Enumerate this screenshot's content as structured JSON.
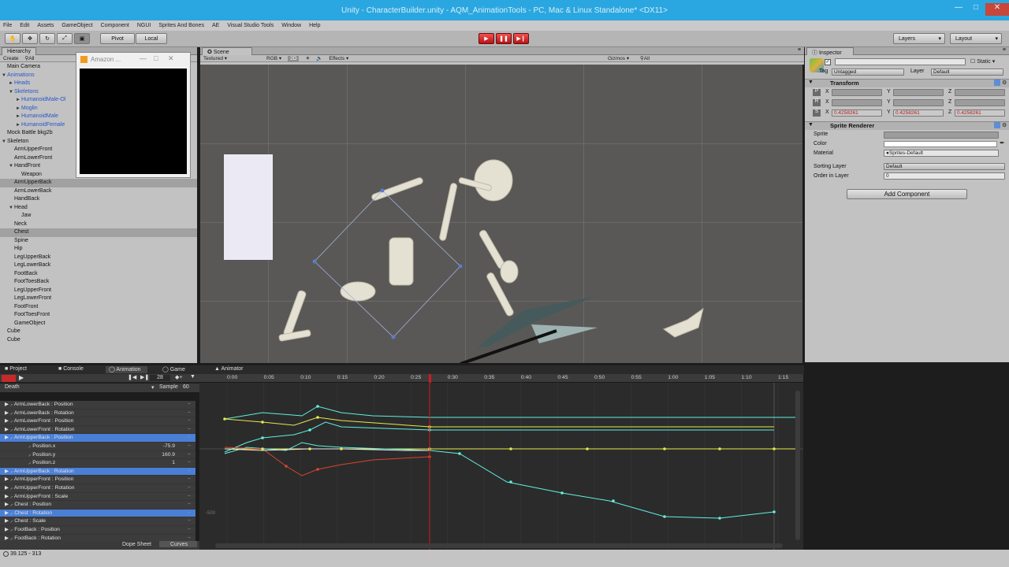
{
  "window": {
    "title": "Unity - CharacterBuilder.unity - AQM_AnimationTools - PC, Mac & Linux Standalone* <DX11>"
  },
  "menu": [
    "File",
    "Edit",
    "Assets",
    "GameObject",
    "Component",
    "NGUI",
    "Sprites And Bones",
    "AE",
    "Visual Studio Tools",
    "Window",
    "Help"
  ],
  "toolbar": {
    "pivot": "Pivot",
    "local": "Local",
    "layers": "Layers",
    "layout": "Layout"
  },
  "hierarchy": {
    "tab": "Hierarchy",
    "create": "Create",
    "search": "All",
    "items": [
      {
        "label": "Main Camera",
        "indent": 0,
        "arrow": "",
        "style": ""
      },
      {
        "label": "Animations",
        "indent": 0,
        "arrow": "▼",
        "style": "blue"
      },
      {
        "label": "Heads",
        "indent": 1,
        "arrow": "►",
        "style": "blue"
      },
      {
        "label": "Skeletons",
        "indent": 1,
        "arrow": "▼",
        "style": "blue"
      },
      {
        "label": "HumanoidMale-Ol",
        "indent": 2,
        "arrow": "►",
        "style": "blue"
      },
      {
        "label": "Moglin",
        "indent": 2,
        "arrow": "►",
        "style": "blue"
      },
      {
        "label": "HumanoidMale",
        "indent": 2,
        "arrow": "►",
        "style": "blue"
      },
      {
        "label": "HumanoidFemale",
        "indent": 2,
        "arrow": "►",
        "style": "blue"
      },
      {
        "label": "Mock Battle bkg2b",
        "indent": 0,
        "arrow": "",
        "style": ""
      },
      {
        "label": "Skeleton",
        "indent": 0,
        "arrow": "▼",
        "style": ""
      },
      {
        "label": "ArmUpperFront",
        "indent": 1,
        "arrow": "",
        "style": ""
      },
      {
        "label": "ArmLowerFront",
        "indent": 1,
        "arrow": "",
        "style": ""
      },
      {
        "label": "HandFront",
        "indent": 1,
        "arrow": "▼",
        "style": ""
      },
      {
        "label": "Weapon",
        "indent": 2,
        "arrow": "",
        "style": ""
      },
      {
        "label": "ArmUpperBack",
        "indent": 1,
        "arrow": "",
        "style": "sel"
      },
      {
        "label": "ArmLowerBack",
        "indent": 1,
        "arrow": "",
        "style": ""
      },
      {
        "label": "HandBack",
        "indent": 1,
        "arrow": "",
        "style": ""
      },
      {
        "label": "Head",
        "indent": 1,
        "arrow": "▼",
        "style": ""
      },
      {
        "label": "Jaw",
        "indent": 2,
        "arrow": "",
        "style": ""
      },
      {
        "label": "Neck",
        "indent": 1,
        "arrow": "",
        "style": ""
      },
      {
        "label": "Chest",
        "indent": 1,
        "arrow": "",
        "style": "sel"
      },
      {
        "label": "Spine",
        "indent": 1,
        "arrow": "",
        "style": ""
      },
      {
        "label": "Hip",
        "indent": 1,
        "arrow": "",
        "style": ""
      },
      {
        "label": "LegUpperBack",
        "indent": 1,
        "arrow": "",
        "style": ""
      },
      {
        "label": "LegLowerBack",
        "indent": 1,
        "arrow": "",
        "style": ""
      },
      {
        "label": "FootBack",
        "indent": 1,
        "arrow": "",
        "style": ""
      },
      {
        "label": "FootToesBack",
        "indent": 1,
        "arrow": "",
        "style": ""
      },
      {
        "label": "LegUpperFront",
        "indent": 1,
        "arrow": "",
        "style": ""
      },
      {
        "label": "LegLowerFront",
        "indent": 1,
        "arrow": "",
        "style": ""
      },
      {
        "label": "FootFront",
        "indent": 1,
        "arrow": "",
        "style": ""
      },
      {
        "label": "FootToesFront",
        "indent": 1,
        "arrow": "",
        "style": ""
      },
      {
        "label": "GameObject",
        "indent": 1,
        "arrow": "",
        "style": ""
      },
      {
        "label": "Cube",
        "indent": 0,
        "arrow": "",
        "style": ""
      },
      {
        "label": "Cube",
        "indent": 0,
        "arrow": "",
        "style": ""
      }
    ]
  },
  "popup": {
    "title": "Amazon ..."
  },
  "scene": {
    "tab": "Scene",
    "shading": "Textured",
    "rgb": "RGB",
    "mode2d": "2D",
    "effects": "Effects",
    "gizmos": "Gizmos",
    "search": "All"
  },
  "inspector": {
    "tab": "Inspector",
    "static": "Static",
    "tag_label": "Tag",
    "tag_value": "Untagged",
    "layer_label": "Layer",
    "layer_value": "Default",
    "transform": "Transform",
    "scale": {
      "x": "0.4258261",
      "y": "0.4258261",
      "z": "0.4258261"
    },
    "axis_labels": [
      "X",
      "Y",
      "Z"
    ],
    "sprite_renderer": "Sprite Renderer",
    "sprite_label": "Sprite",
    "color_label": "Color",
    "material_label": "Material",
    "material_value": "Sprites-Default",
    "sorting_layer_label": "Sorting Layer",
    "sorting_layer_value": "Default",
    "order_label": "Order in Layer",
    "order_value": "0",
    "add_component": "Add Component"
  },
  "bottom_tabs": {
    "project": "Project",
    "console": "Console",
    "animation": "Animation",
    "game": "Game",
    "animator": "Animator"
  },
  "animation": {
    "frame": "28",
    "clip": "Death",
    "sample_label": "Sample",
    "sample_value": "60",
    "dope_sheet": "Dope Sheet",
    "curves": "Curves",
    "ruler": [
      "0:00",
      "0:05",
      "0:10",
      "0:15",
      "0:20",
      "0:25",
      "0:30",
      "0:35",
      "0:40",
      "0:45",
      "0:50",
      "0:55",
      "1:00",
      "1:05",
      "1:10",
      "1:15"
    ],
    "axis_label": "-500",
    "rows": [
      {
        "label": "ArmLowerBack : Position",
        "kind": "prop",
        "value": "",
        "hl": false
      },
      {
        "label": "ArmLowerBack : Rotation",
        "kind": "prop",
        "value": "",
        "hl": false
      },
      {
        "label": "ArmLowerFront : Position",
        "kind": "prop",
        "value": "",
        "hl": false
      },
      {
        "label": "ArmLowerFront : Rotation",
        "kind": "prop",
        "value": "",
        "hl": false
      },
      {
        "label": "ArmUpperBack : Position",
        "kind": "prop",
        "value": "",
        "hl": true
      },
      {
        "label": "Position.x",
        "kind": "sub",
        "value": "-75.9",
        "hl": false
      },
      {
        "label": "Position.y",
        "kind": "sub",
        "value": "160.9",
        "hl": false
      },
      {
        "label": "Position.z",
        "kind": "sub",
        "value": "1",
        "hl": false
      },
      {
        "label": "ArmUpperBack : Rotation",
        "kind": "prop",
        "value": "",
        "hl": true
      },
      {
        "label": "ArmUpperFront : Position",
        "kind": "prop",
        "value": "",
        "hl": false
      },
      {
        "label": "ArmUpperFront : Rotation",
        "kind": "prop",
        "value": "",
        "hl": false
      },
      {
        "label": "ArmUpperFront : Scale",
        "kind": "prop",
        "value": "",
        "hl": false
      },
      {
        "label": "Chest : Position",
        "kind": "prop",
        "value": "",
        "hl": false
      },
      {
        "label": "Chest : Rotation",
        "kind": "prop",
        "value": "",
        "hl": true
      },
      {
        "label": "Chest : Scale",
        "kind": "prop",
        "value": "",
        "hl": false
      },
      {
        "label": "FootBack : Position",
        "kind": "prop",
        "value": "",
        "hl": false
      },
      {
        "label": "FootBack : Rotation",
        "kind": "prop",
        "value": "",
        "hl": false
      }
    ]
  },
  "status": {
    "text": "39.125 - 313"
  },
  "colors": {
    "accent_blue": "#4a7fd6",
    "curve_cyan": "#5ff0e0",
    "curve_yellow": "#e8e84a",
    "curve_red": "#d9452f",
    "playhead": "#d11a1a"
  }
}
